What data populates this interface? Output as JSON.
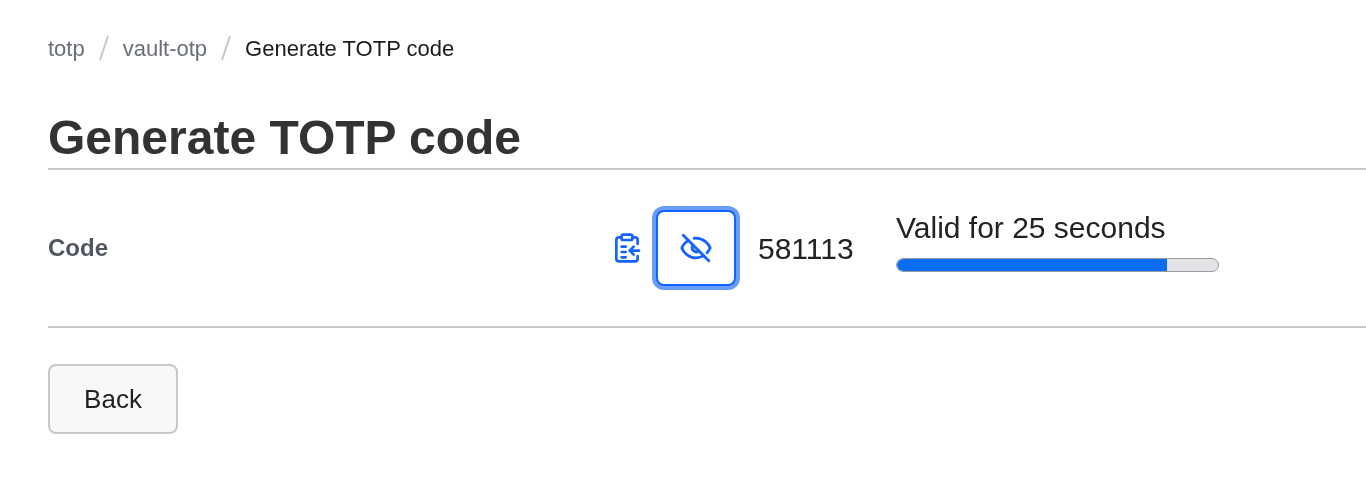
{
  "breadcrumb": [
    {
      "label": "totp",
      "current": false
    },
    {
      "label": "vault-otp",
      "current": false
    },
    {
      "label": "Generate TOTP code",
      "current": true
    }
  ],
  "title": "Generate TOTP code",
  "field": {
    "label": "Code",
    "code": "581113",
    "visibility_button": {
      "focused": true
    },
    "timer": {
      "text": "Valid for 25 seconds",
      "level": 0.84
    }
  },
  "buttons": [
    "Back"
  ]
}
